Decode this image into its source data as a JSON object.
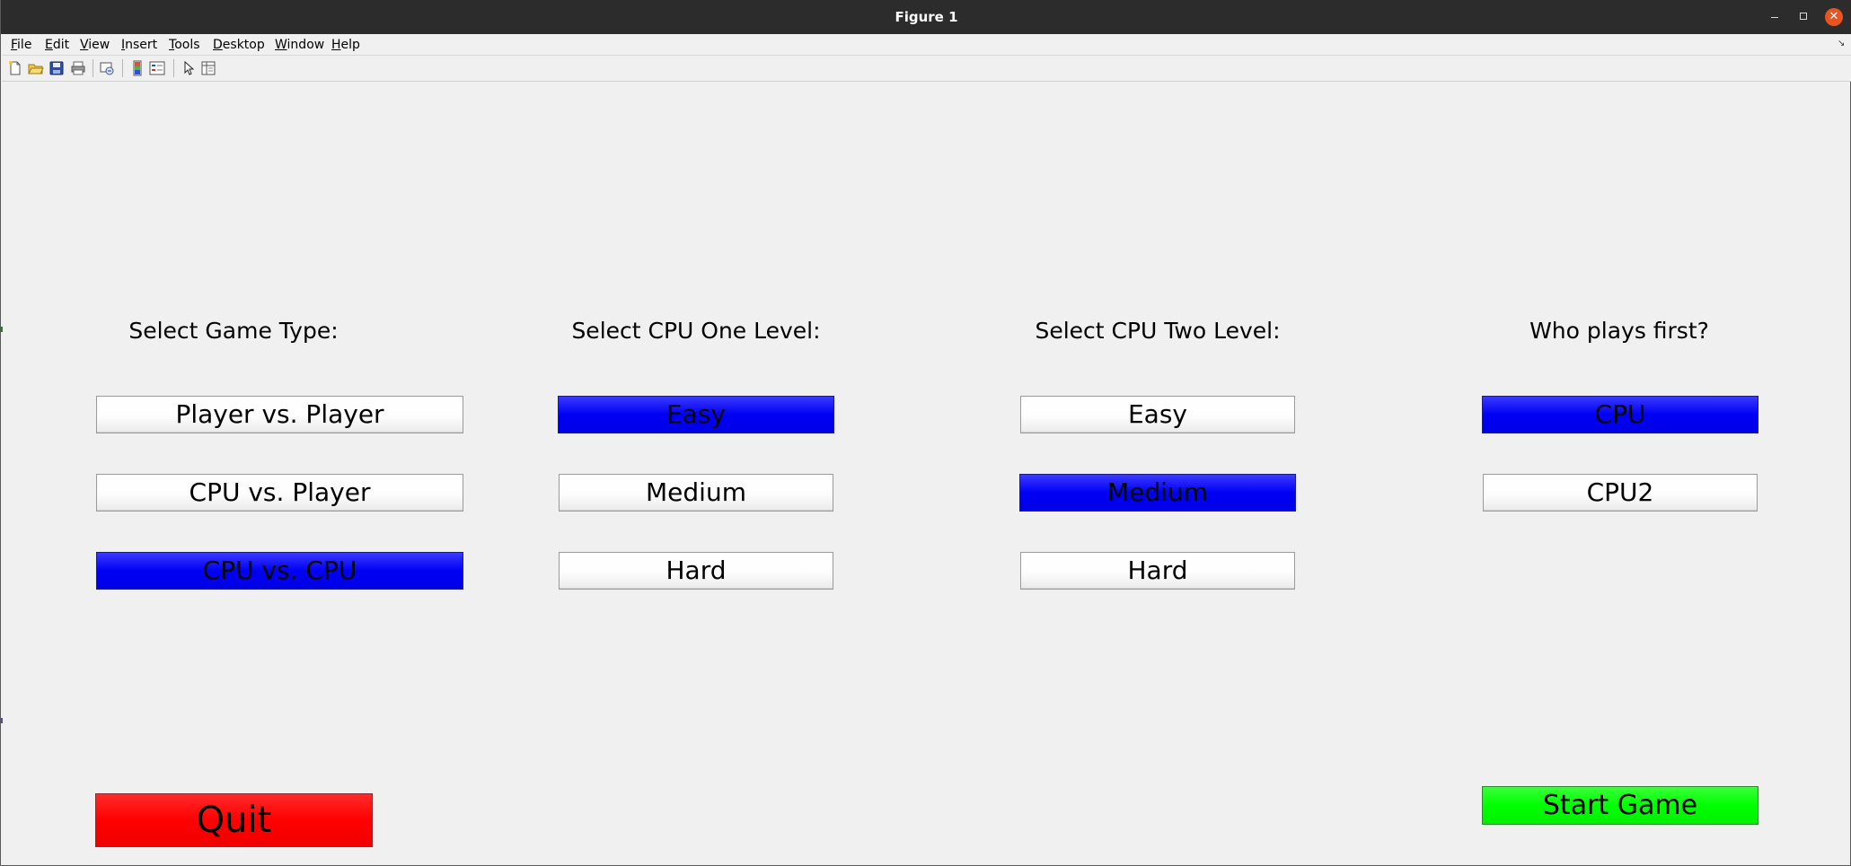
{
  "window": {
    "title": "Figure 1",
    "controls": {
      "minimize": "minimize-icon",
      "maximize": "maximize-icon",
      "close": "close-icon"
    }
  },
  "menubar": {
    "items": [
      {
        "label": "File",
        "accel": "F"
      },
      {
        "label": "Edit",
        "accel": "E"
      },
      {
        "label": "View",
        "accel": "V"
      },
      {
        "label": "Insert",
        "accel": "I"
      },
      {
        "label": "Tools",
        "accel": "T"
      },
      {
        "label": "Desktop",
        "accel": "D"
      },
      {
        "label": "Window",
        "accel": "W"
      },
      {
        "label": "Help",
        "accel": "H"
      }
    ]
  },
  "toolbar": {
    "tools": [
      "new-figure-icon",
      "open-file-icon",
      "save-icon",
      "print-icon",
      "link-plot-icon",
      "colorbar-icon",
      "legend-icon",
      "edit-plot-arrow-icon",
      "property-inspector-icon"
    ]
  },
  "game_type": {
    "label": "Select Game Type:",
    "options": [
      "Player vs. Player",
      "CPU vs. Player",
      "CPU vs. CPU"
    ],
    "selected": "CPU vs. CPU"
  },
  "cpu_one": {
    "label": "Select CPU One Level:",
    "options": [
      "Easy",
      "Medium",
      "Hard"
    ],
    "selected": "Easy"
  },
  "cpu_two": {
    "label": "Select CPU Two Level:",
    "options": [
      "Easy",
      "Medium",
      "Hard"
    ],
    "selected": "Medium"
  },
  "first_player": {
    "label": "Who plays first?",
    "options": [
      "CPU",
      "CPU2"
    ],
    "selected": "CPU"
  },
  "actions": {
    "quit_label": "Quit",
    "start_label": "Start Game"
  },
  "colors": {
    "selected": "#0000ff",
    "unselected": "#ffffff",
    "quit": "#ff0000",
    "start": "#00ff00"
  }
}
